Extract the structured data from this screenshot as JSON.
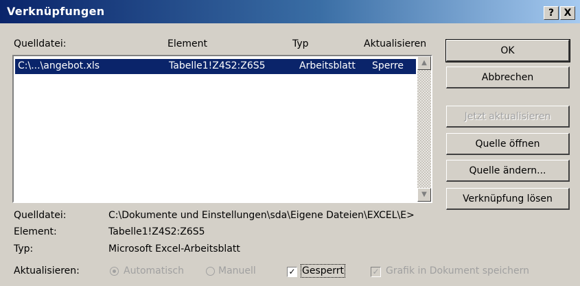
{
  "window": {
    "title": "Verknüpfungen",
    "help": "?",
    "close": "X"
  },
  "list": {
    "headers": [
      "Quelldatei:",
      "Element",
      "Typ",
      "Aktualisieren"
    ],
    "rows": [
      {
        "source": "C:\\...\\angebot.xls",
        "element": "Tabelle1!Z4S2:Z6S5",
        "type": "Arbeitsblatt",
        "update": "Sperre"
      }
    ]
  },
  "buttons": {
    "ok": "OK",
    "cancel": "Abbrechen",
    "update_now": "Jetzt aktualisieren",
    "open_source": "Quelle öffnen",
    "change_source": "Quelle ändern...",
    "break_link": "Verknüpfung lösen"
  },
  "details": {
    "source_label": "Quelldatei:",
    "source_value": "C:\\Dokumente und Einstellungen\\sda\\Eigene Dateien\\EXCEL\\E>",
    "element_label": "Element:",
    "element_value": "Tabelle1!Z4S2:Z6S5",
    "type_label": "Typ:",
    "type_value": "Microsoft Excel-Arbeitsblatt",
    "update_label": "Aktualisieren:"
  },
  "options": {
    "automatic": "Automatisch",
    "manual": "Manuell",
    "locked": "Gesperrt",
    "save_picture": "Grafik in Dokument speichern"
  },
  "colors": {
    "title_start": "#0a246a",
    "title_end": "#a6caf0",
    "selection": "#0a246a",
    "face": "#d4d0c8"
  }
}
